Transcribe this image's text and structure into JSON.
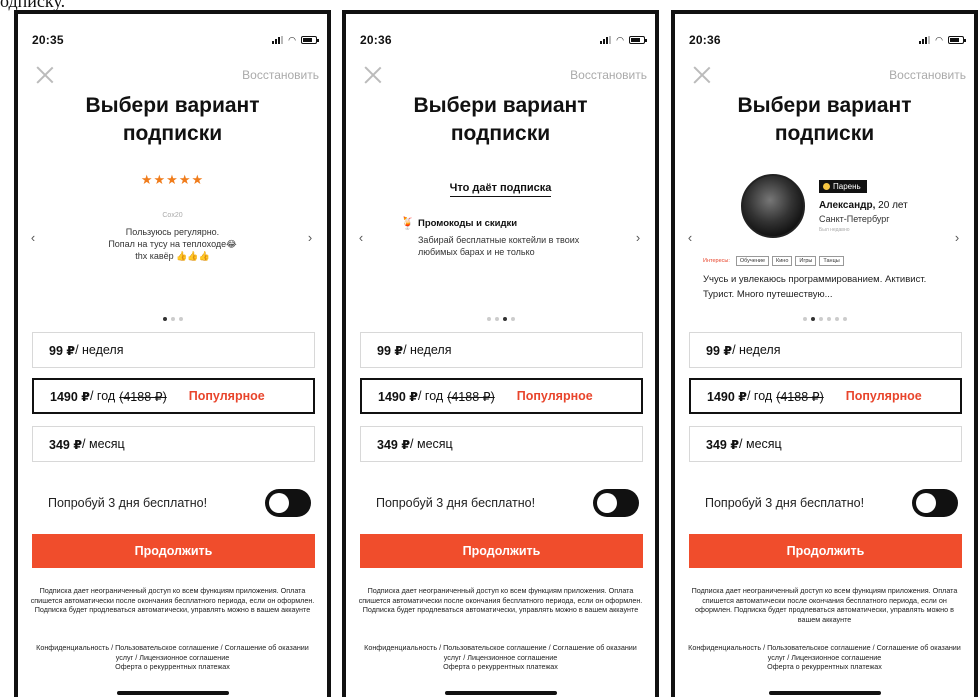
{
  "top_cut_text": "одписку.",
  "phones": [
    {
      "time": "20:35",
      "restore": "Восстановить",
      "heading_line1": "Выбери вариант",
      "heading_line2": "подписки",
      "review": {
        "stars": "★★★★★",
        "author": "Cox20",
        "line1": "Пользуюсь регулярно.",
        "line2": "Попал на тусу на теплоходе😂",
        "line3": "thx кавёр 👍👍👍"
      },
      "arrow_left": "‹",
      "arrow_right": "›",
      "plans": {
        "week_price": "99 ₽",
        "week_period": " / неделя",
        "year_price": "1490 ₽",
        "year_period": " / год",
        "year_old": "(4188 ₽)",
        "year_badge": "Популярное",
        "month_price": "349 ₽",
        "month_period": " / месяц"
      },
      "trial_label": "Попробуй 3 дня бесплатно!",
      "continue": "Продолжить",
      "legal_text": "Подписка дает неограниченный доступ ко всем функциям приложения. Оплата спишется автоматически после окончания бесплатного периода, если он оформлен. Подписка будет продлеваться автоматически, управлять можно в вашем аккаунте",
      "links": {
        "privacy": "Конфиденциальность",
        "user_agreement": "Пользовательское соглашение",
        "services": "Соглашение об оказании услуг",
        "license": "Лицензионное соглашение",
        "offer": "Оферта о рекуррентных платежах"
      }
    },
    {
      "time": "20:36",
      "restore": "Восстановить",
      "heading_line1": "Выбери вариант",
      "heading_line2": "подписки",
      "benefits": {
        "title": "Что даёт подписка",
        "icon": "🍹",
        "name": "Промокоды и скидки",
        "desc": "Забирай бесплатные коктейли в твоих любимых барах и не только"
      },
      "arrow_left": "‹",
      "arrow_right": "›",
      "plans": {
        "week_price": "99 ₽",
        "week_period": " / неделя",
        "year_price": "1490 ₽",
        "year_period": " / год",
        "year_old": "(4188 ₽)",
        "year_badge": "Популярное",
        "month_price": "349 ₽",
        "month_period": " / месяц"
      },
      "trial_label": "Попробуй 3 дня бесплатно!",
      "continue": "Продолжить",
      "legal_text": "Подписка дает неограниченный доступ ко всем функциям приложения. Оплата спишется автоматически после окончания бесплатного периода, если он оформлен. Подписка будет продлеваться автоматически, управлять можно в вашем аккаунте",
      "links": {
        "privacy": "Конфиденциальность",
        "user_agreement": "Пользовательское соглашение",
        "services": "Соглашение об оказании услуг",
        "license": "Лицензионное соглашение",
        "offer": "Оферта о рекуррентных платежах"
      }
    },
    {
      "time": "20:36",
      "restore": "Восстановить",
      "heading_line1": "Выбери вариант",
      "heading_line2": "подписки",
      "profile": {
        "badge": "Парень",
        "name": "Александр,",
        "age": " 20 лет",
        "city": "Санкт-Петербург",
        "online": "Был недавно",
        "interests_label": "Интересы:",
        "tags": [
          "Обучение",
          "Кино",
          "Игры",
          "Танцы"
        ],
        "bio": "Учусь и увлекаюсь программированием. Активист. Турист. Много путешествую..."
      },
      "arrow_left": "‹",
      "arrow_right": "›",
      "plans": {
        "week_price": "99 ₽",
        "week_period": " / неделя",
        "year_price": "1490 ₽",
        "year_period": " / год",
        "year_old": "(4188 ₽)",
        "year_badge": "Популярное",
        "month_price": "349 ₽",
        "month_period": " / месяц"
      },
      "trial_label": "Попробуй 3 дня бесплатно!",
      "continue": "Продолжить",
      "legal_text": "Подписка дает неограниченный доступ ко всем функциям приложения. Оплата спишется автоматически после окончания бесплатного периода, если он оформлен. Подписка будет продлеваться автоматически, управлять можно в вашем аккаунте",
      "links": {
        "privacy": "Конфиденциальность",
        "user_agreement": "Пользовательское соглашение",
        "services": "Соглашение об оказании услуг",
        "license": "Лицензионное соглашение",
        "offer": "Оферта о рекуррентных платежах"
      }
    }
  ],
  "accent_color": "#f04d2c",
  "popular_color": "#e8452c"
}
